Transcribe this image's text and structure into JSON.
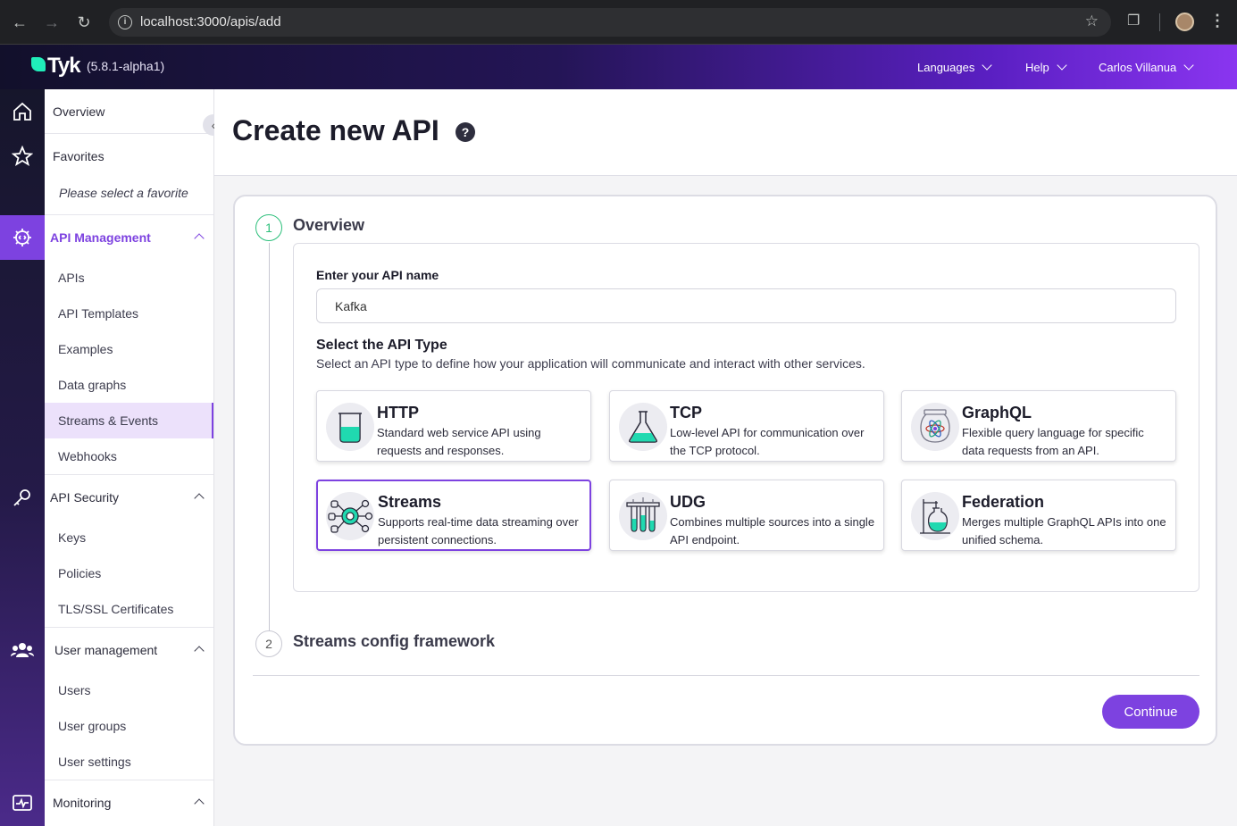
{
  "browser": {
    "url": "localhost:3000/apis/add"
  },
  "header": {
    "logo_text": "Tyk",
    "version": "(5.8.1-alpha1)",
    "nav": [
      {
        "label": "Languages"
      },
      {
        "label": "Help"
      },
      {
        "label": "Carlos Villanua"
      }
    ]
  },
  "sidebar": {
    "overview": "Overview",
    "favorites": "Favorites",
    "favorites_placeholder": "Please select a favorite",
    "api_management": {
      "label": "API Management",
      "items": [
        "APIs",
        "API Templates",
        "Examples",
        "Data graphs",
        "Streams & Events",
        "Webhooks"
      ],
      "active": "Streams & Events"
    },
    "api_security": {
      "label": "API Security",
      "items": [
        "Keys",
        "Policies",
        "TLS/SSL Certificates"
      ]
    },
    "user_management": {
      "label": "User management",
      "items": [
        "Users",
        "User groups",
        "User settings"
      ]
    },
    "monitoring": {
      "label": "Monitoring"
    }
  },
  "main": {
    "title": "Create new API",
    "help_glyph": "?",
    "steps": [
      {
        "number": "1",
        "title": "Overview"
      },
      {
        "number": "2",
        "title": "Streams config framework"
      }
    ],
    "form": {
      "name_label": "Enter your API name",
      "name_value": "Kafka",
      "type_title": "Select the API Type",
      "type_description": "Select an API type to define how your application will communicate and interact with other services.",
      "types": [
        {
          "name": "HTTP",
          "description": "Standard web service API using requests and responses.",
          "icon": "beaker-icon"
        },
        {
          "name": "TCP",
          "description": "Low-level API for communication over the TCP protocol.",
          "icon": "flask-icon"
        },
        {
          "name": "GraphQL",
          "description": "Flexible query language for specific data requests from an API.",
          "icon": "atom-jar-icon"
        },
        {
          "name": "Streams",
          "description": "Supports real-time data streaming over persistent connections.",
          "icon": "streams-hub-icon",
          "selected": true
        },
        {
          "name": "UDG",
          "description": "Combines multiple sources into a single API endpoint.",
          "icon": "test-tubes-icon"
        },
        {
          "name": "Federation",
          "description": "Merges multiple GraphQL APIs into one unified schema.",
          "icon": "lab-stand-icon"
        }
      ]
    },
    "continue_label": "Continue"
  },
  "colors": {
    "accent": "#7d42e0",
    "step_done": "#2bbf7a",
    "icon_teal": "#20d9b0"
  }
}
